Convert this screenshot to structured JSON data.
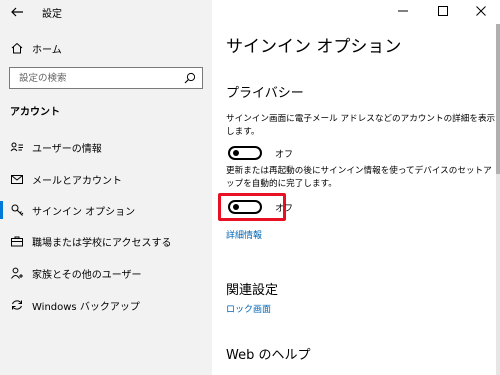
{
  "app": {
    "title": "設定"
  },
  "sidebar": {
    "home_label": "ホーム",
    "search_placeholder": "設定の検索",
    "section_label": "アカウント",
    "items": [
      {
        "label": "ユーザーの情報",
        "icon": "user-card-icon",
        "active": false
      },
      {
        "label": "メールとアカウント",
        "icon": "mail-icon",
        "active": false
      },
      {
        "label": "サインイン オプション",
        "icon": "key-icon",
        "active": true
      },
      {
        "label": "職場または学校にアクセスする",
        "icon": "briefcase-icon",
        "active": false
      },
      {
        "label": "家族とその他のユーザー",
        "icon": "add-user-icon",
        "active": false
      },
      {
        "label": "Windows バックアップ",
        "icon": "sync-icon",
        "active": false
      }
    ]
  },
  "main": {
    "page_title": "サインイン オプション",
    "privacy": {
      "heading": "プライバシー",
      "setting1_description": "サインイン画面に電子メール アドレスなどのアカウントの詳細を表示します。",
      "setting1_state": "オフ",
      "setting2_description": "更新または再起動の後にサインイン情報を使ってデバイスのセットアップを自動的に完了します。",
      "setting2_state": "オフ",
      "details_link": "詳細情報"
    },
    "related": {
      "heading": "関連設定",
      "lock_screen_link": "ロック画面"
    },
    "web_help": {
      "heading": "Web のヘルプ"
    }
  },
  "colors": {
    "accent": "#0078d7",
    "link": "#0066b4",
    "highlight": "#e81123",
    "sidebar_bg": "#f2f2f2"
  }
}
